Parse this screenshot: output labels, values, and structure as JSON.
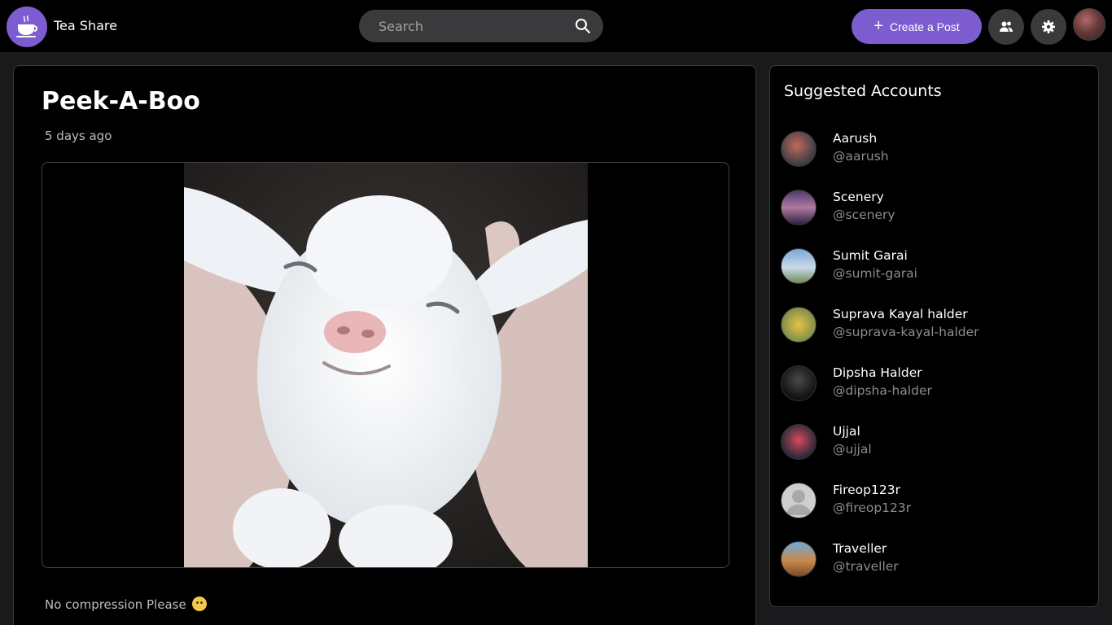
{
  "header": {
    "app_name": "Tea Share",
    "search_placeholder": "Search",
    "create_post_label": "Create a Post"
  },
  "post": {
    "title": "Peek-A-Boo",
    "time_ago": "5 days ago",
    "caption": "No compression Please"
  },
  "suggested": {
    "title": "Suggested Accounts",
    "accounts": [
      {
        "name": "Aarush",
        "handle": "@aarush"
      },
      {
        "name": "Scenery",
        "handle": "@scenery"
      },
      {
        "name": "Sumit Garai",
        "handle": "@sumit-garai"
      },
      {
        "name": "Suprava Kayal halder",
        "handle": "@suprava-kayal-halder"
      },
      {
        "name": "Dipsha Halder",
        "handle": "@dipsha-halder"
      },
      {
        "name": "Ujjal",
        "handle": "@ujjal"
      },
      {
        "name": "Fireop123r",
        "handle": "@fireop123r"
      },
      {
        "name": "Traveller",
        "handle": "@traveller"
      }
    ]
  },
  "icons": {
    "search": "search-icon",
    "plus": "plus-icon",
    "people": "people-icon",
    "settings": "gear-icon",
    "logo": "tea-cup-icon"
  },
  "colors": {
    "accent": "#7c5ccf",
    "background": "#000000",
    "muted_text": "#8c8c8c"
  }
}
